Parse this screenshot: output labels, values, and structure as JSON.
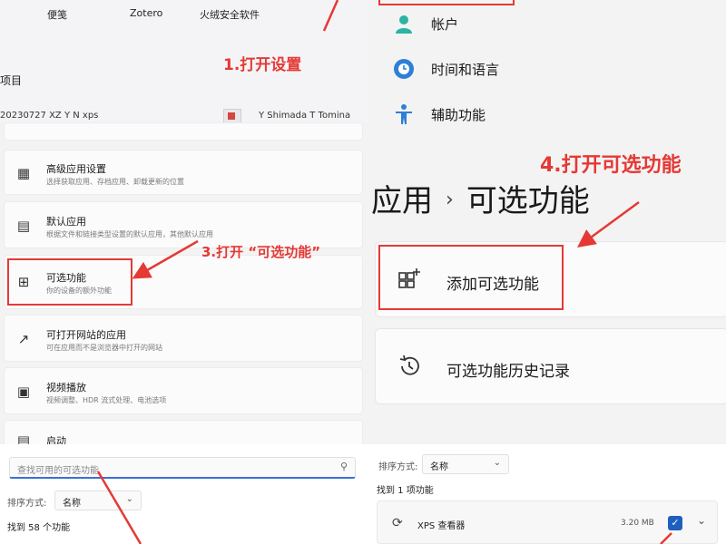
{
  "start_menu": {
    "pinned": [
      {
        "label": "便笺"
      },
      {
        "label": "Zotero"
      },
      {
        "label": "火绒安全软件"
      }
    ],
    "recommended_title": "项目",
    "file_left": "20230727 XZ Y N xps",
    "file_right": "Y Shimada T Tomina"
  },
  "annotations": {
    "step1": "1.打开设置",
    "step3": "3.打开 “可选功能”",
    "step4": "4.打开可选功能"
  },
  "apps_settings": {
    "cards": [
      {
        "title": "",
        "desc": "",
        "icon": "blank-icon"
      },
      {
        "title": "高级应用设置",
        "desc": "选择获取应用、存档应用、卸载更新的位置",
        "icon": "advanced-apps-icon"
      },
      {
        "title": "默认应用",
        "desc": "根据文件和链接类型设置的默认应用，其他默认应用",
        "icon": "default-apps-icon"
      },
      {
        "title": "可选功能",
        "desc": "你的设备的额外功能",
        "icon": "optional-features-icon"
      },
      {
        "title": "可打开网站的应用",
        "desc": "可在应用而不是浏览器中打开的网站",
        "icon": "apps-for-websites-icon"
      },
      {
        "title": "视频播放",
        "desc": "视频调整、HDR 流式处理、电池选项",
        "icon": "video-playback-icon"
      },
      {
        "title": "启动",
        "desc": "",
        "icon": "startup-icon"
      }
    ]
  },
  "search_panel": {
    "search_placeholder": "查找可用的可选功能",
    "sort_label": "排序方式:",
    "sort_value": "名称",
    "found_text": "找到 58 个功能"
  },
  "settings_nav": {
    "items": [
      {
        "label": "帐户",
        "icon": "account-icon"
      },
      {
        "label": "时间和语言",
        "icon": "time-language-icon"
      },
      {
        "label": "辅助功能",
        "icon": "accessibility-icon"
      }
    ]
  },
  "optional_features_page": {
    "breadcrumb_parent": "应用",
    "breadcrumb_sep": "›",
    "breadcrumb_current": "可选功能",
    "add_label": "添加可选功能",
    "history_label": "可选功能历史记录"
  },
  "result_panel": {
    "sort_label": "排序方式:",
    "sort_value": "名称",
    "found_text": "找到 1 项功能",
    "item_name": "XPS 查看器",
    "item_size": "3.20 MB"
  },
  "colors": {
    "annotation_red": "#e53935",
    "accent_blue": "#1f5fbf"
  }
}
